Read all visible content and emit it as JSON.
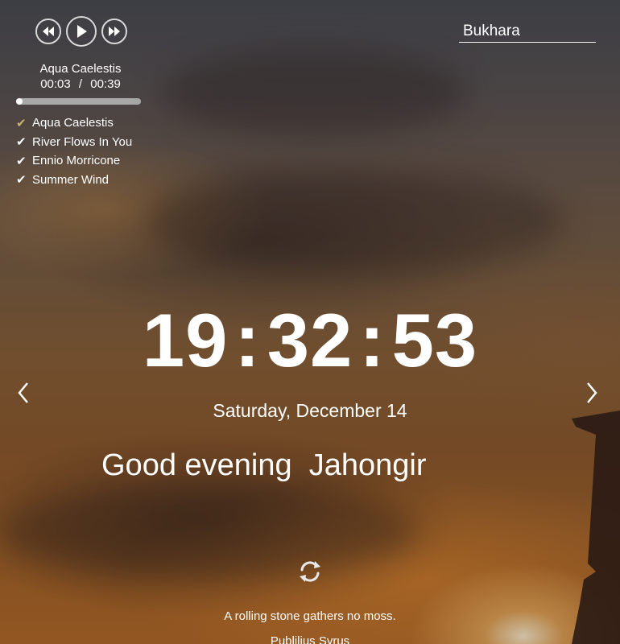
{
  "player": {
    "controls": {
      "prev_icon": "rewind-icon",
      "play_icon": "play-icon",
      "next_icon": "fast-forward-icon"
    },
    "track_title": "Aqua Caelestis",
    "current_time": "00:03",
    "time_separator": "/",
    "duration": "00:39",
    "progress_fraction": 0.05,
    "playlist": [
      {
        "label": "Aqua Caelestis",
        "active": true
      },
      {
        "label": "River Flows In You",
        "active": false
      },
      {
        "label": "Ennio Morricone",
        "active": false
      },
      {
        "label": "Summer Wind",
        "active": false
      }
    ],
    "check_glyph": "✔",
    "active_color": "#c9b36a"
  },
  "city": {
    "value": "Bukhara"
  },
  "clock": {
    "hours": "19",
    "minutes": "32",
    "seconds": "53",
    "separator": ":"
  },
  "date": "Saturday, December 14",
  "greeting": {
    "text": "Good evening",
    "name": "Jahongir"
  },
  "slider": {
    "prev_icon": "chevron-left-icon",
    "next_icon": "chevron-right-icon"
  },
  "quote": {
    "refresh_icon": "refresh-icon",
    "text": "A rolling stone gathers no moss.",
    "author": "Publilius Syrus"
  }
}
